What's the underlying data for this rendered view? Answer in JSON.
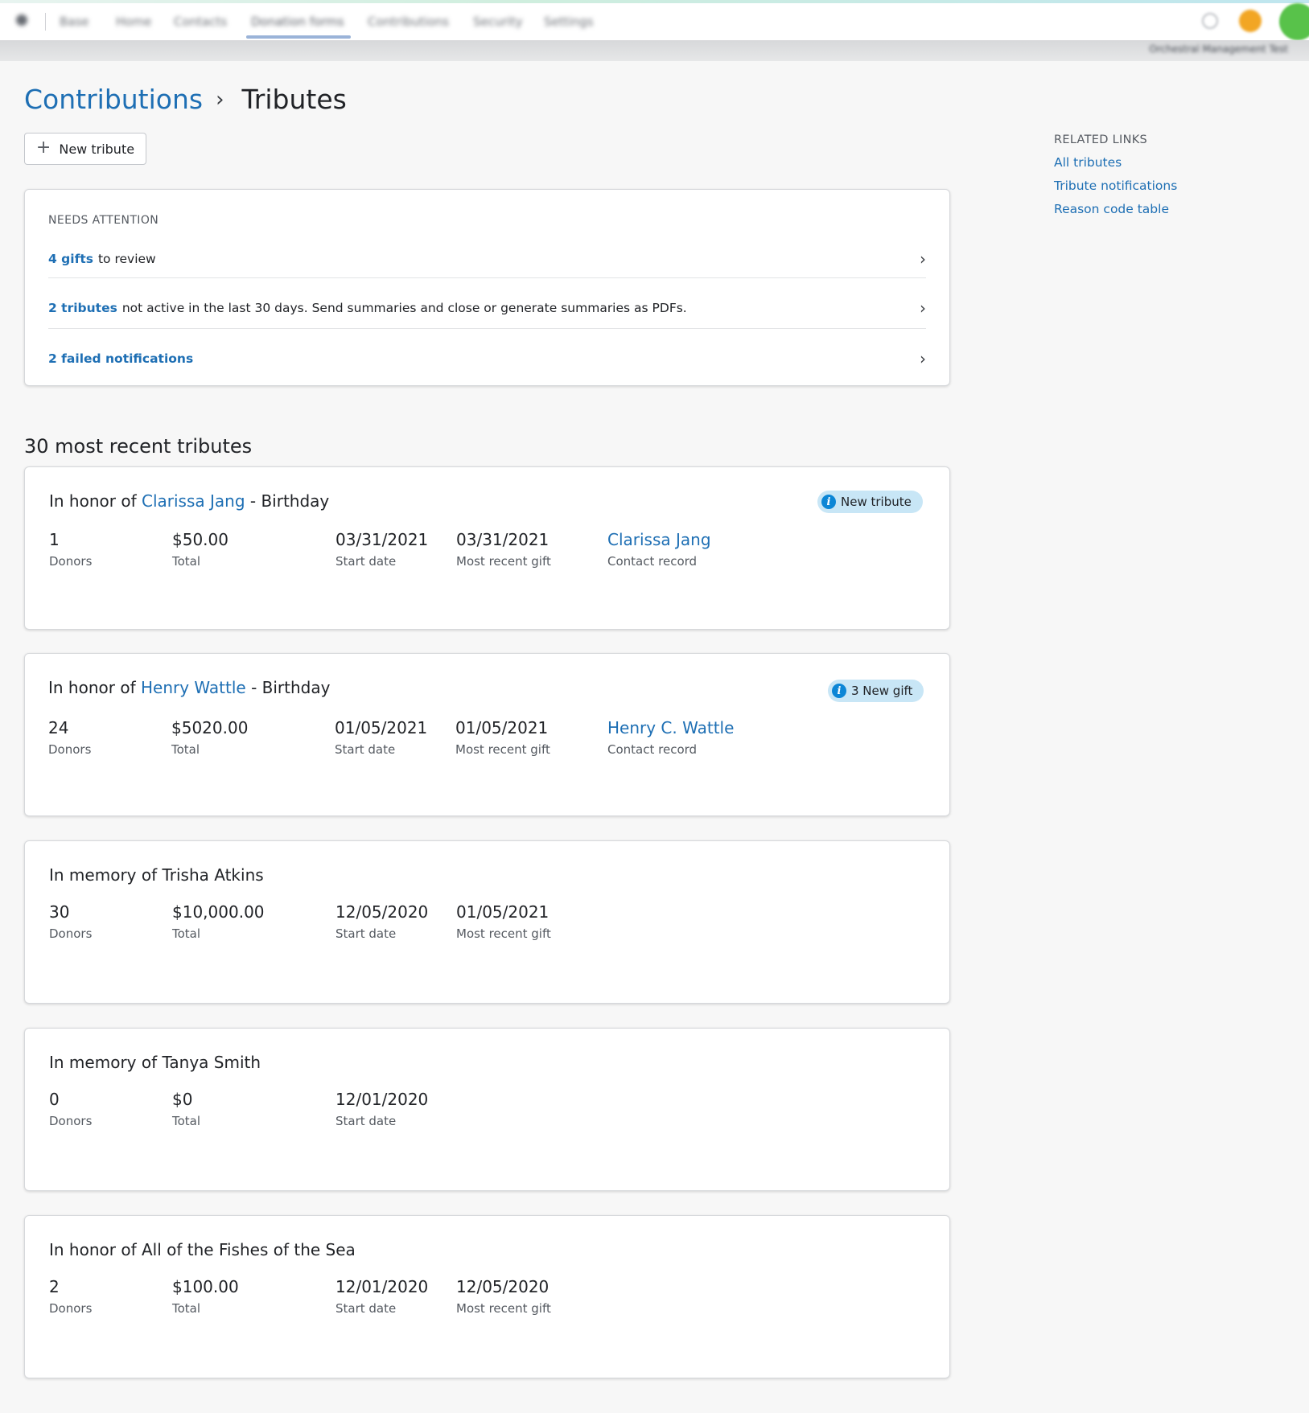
{
  "topnav": {
    "tabs": [
      "Base",
      "Home",
      "Contacts",
      "Donation forms",
      "Contributions",
      "Security",
      "Settings"
    ],
    "active_tab": "Donation forms",
    "org_name": "Orchestral Management Test"
  },
  "breadcrumb": {
    "parent": "Contributions",
    "separator": "›",
    "current": "Tributes"
  },
  "new_tribute_button": {
    "icon": "plus-icon",
    "label": "New tribute"
  },
  "needs_attention": {
    "heading": "NEEDS ATTENTION",
    "items": [
      {
        "link": "4 gifts",
        "text": "to review"
      },
      {
        "link": "2 tributes",
        "text": "not active in the last 30 days. Send summaries and close or generate summaries as PDFs."
      },
      {
        "link": "2 failed notifications",
        "text": ""
      }
    ]
  },
  "recent_title": "30 most recent tributes",
  "labels": {
    "donors": "Donors",
    "total": "Total",
    "start_date": "Start date",
    "recent_gift": "Most recent gift",
    "contact": "Contact record"
  },
  "tributes": [
    {
      "prefix": "In honor of",
      "name": "Clarissa Jang",
      "suffix": "- Birthday",
      "badge": "New tribute",
      "donors": "1",
      "total": "$50.00",
      "start_date": "03/31/2021",
      "recent_gift": "03/31/2021",
      "contact": "Clarissa Jang"
    },
    {
      "prefix": "In honor of",
      "name": "Henry Wattle",
      "suffix": "- Birthday",
      "badge": "3 New gift",
      "donors": "24",
      "total": "$5020.00",
      "start_date": "01/05/2021",
      "recent_gift": "01/05/2021",
      "contact": "Henry C. Wattle"
    },
    {
      "prefix": "In memory of Trisha Atkins",
      "donors": "30",
      "total": "$10,000.00",
      "start_date": "12/05/2020",
      "recent_gift": "01/05/2021"
    },
    {
      "prefix": "In memory of Tanya Smith",
      "donors": "0",
      "total": "$0",
      "start_date": "12/01/2020"
    },
    {
      "prefix": "In honor of All of the Fishes of the Sea",
      "donors": "2",
      "total": "$100.00",
      "start_date": "12/01/2020",
      "recent_gift": "12/05/2020"
    }
  ],
  "related_links": {
    "heading": "RELATED LINKS",
    "links": [
      "All tributes",
      "Tribute notifications",
      "Reason code table"
    ]
  },
  "colors": {
    "link": "#1e6fb4",
    "badge_bg": "#c8e6f6",
    "info_icon": "#0c86d6",
    "page_bg": "#f7f7f7"
  }
}
